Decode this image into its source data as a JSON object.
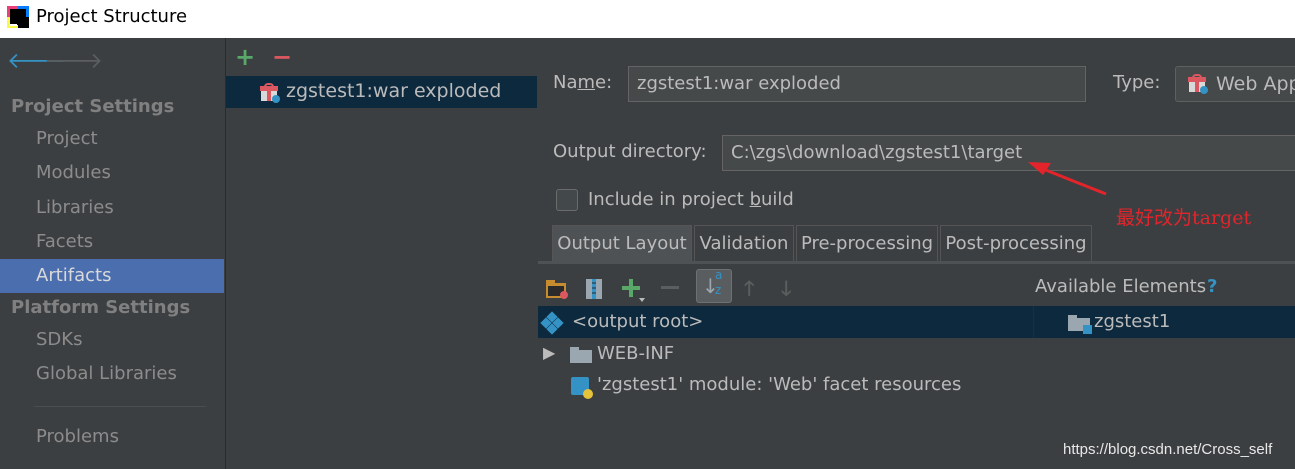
{
  "window": {
    "title": "Project Structure"
  },
  "sidebar": {
    "sections": [
      {
        "title": "Project Settings",
        "items": [
          "Project",
          "Modules",
          "Libraries",
          "Facets",
          "Artifacts"
        ]
      },
      {
        "title": "Platform Settings",
        "items": [
          "SDKs",
          "Global Libraries"
        ]
      }
    ],
    "bottom_item": "Problems",
    "selected": "Artifacts"
  },
  "artifact_list": {
    "add_label": "+",
    "remove_label": "−",
    "items": [
      {
        "label": "zgstest1:war exploded",
        "icon": "war-artifact-icon"
      }
    ]
  },
  "artifact_details": {
    "name_label_pre": "Na",
    "name_label_mnemonic": "m",
    "name_label_post": "e:",
    "name_value": "zgstest1:war exploded",
    "type_label": "Type:",
    "type_value": "Web App",
    "output_dir_label": "Output directory:",
    "output_dir_value": "C:\\zgs\\download\\zgstest1\\target",
    "include_label_pre": "Include in project ",
    "include_label_mnemonic": "b",
    "include_label_post": "uild",
    "include_checked": false
  },
  "annotation": {
    "text": "最好改为target",
    "color": "#e3242b"
  },
  "tabs": [
    "Output Layout",
    "Validation",
    "Pre-processing",
    "Post-processing"
  ],
  "active_tab": "Output Layout",
  "layout_toolbar": {
    "available_elements_label": "Available Elements",
    "help_label": "?",
    "sort_label_top": "a",
    "sort_label_bottom": "z"
  },
  "output_tree": {
    "root": "<output root>",
    "children": [
      "WEB-INF",
      "'zgstest1' module: 'Web' facet resources"
    ]
  },
  "available_tree": {
    "items": [
      "zgstest1"
    ]
  },
  "watermark": "https://blog.csdn.net/Cross_self",
  "colors": {
    "selection": "#4b6eaf",
    "tree_selection": "#0d293e",
    "accent": "#3592c4",
    "add": "#59a869",
    "remove": "#db5860"
  }
}
